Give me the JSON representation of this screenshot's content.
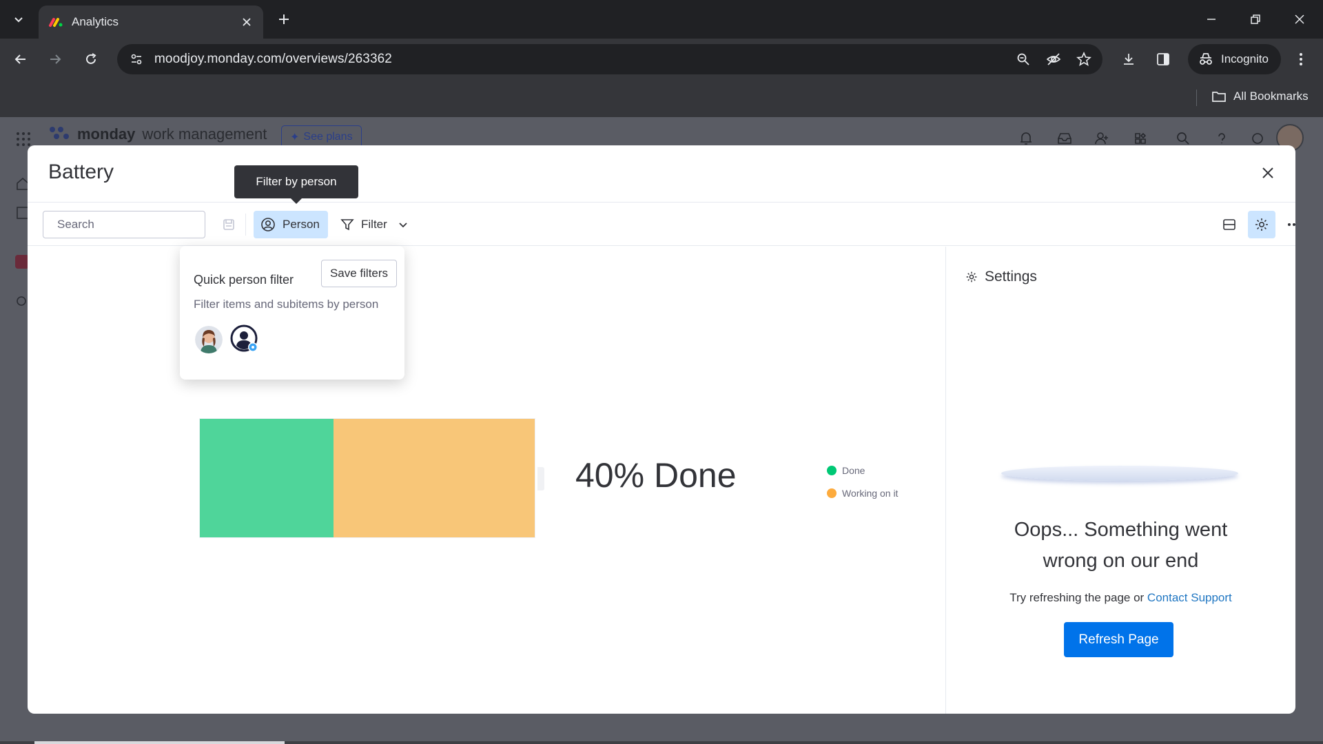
{
  "browser": {
    "tab_title": "Analytics",
    "url": "moodjoy.monday.com/overviews/263362",
    "incognito_label": "Incognito",
    "bookmarks_label": "All Bookmarks"
  },
  "app": {
    "logo_text": "monday",
    "logo_sub": "work management",
    "see_plans": "See plans"
  },
  "modal": {
    "title": "Battery",
    "search_placeholder": "Search",
    "person_label": "Person",
    "filter_label": "Filter",
    "tooltip": "Filter by person"
  },
  "person_popover": {
    "title": "Quick person filter",
    "save_filters": "Save filters",
    "subtitle": "Filter items and subitems by person"
  },
  "chart_data": {
    "type": "battery",
    "done_label": "40% Done",
    "segments": [
      {
        "name": "Done",
        "value": 40,
        "color": "#4fd59a"
      },
      {
        "name": "Working on it",
        "value": 60,
        "color": "#f8c678"
      }
    ],
    "legend": [
      {
        "name": "Done",
        "color": "#00c875"
      },
      {
        "name": "Working on it",
        "color": "#fdab3d"
      }
    ]
  },
  "settings": {
    "title": "Settings",
    "error_title": "Oops... Something went wrong on our end",
    "error_sub_prefix": "Try refreshing the page or ",
    "error_link": "Contact Support",
    "refresh_button": "Refresh Page"
  },
  "colors": {
    "accent": "#0073ea",
    "person_active_bg": "#cce5ff"
  }
}
